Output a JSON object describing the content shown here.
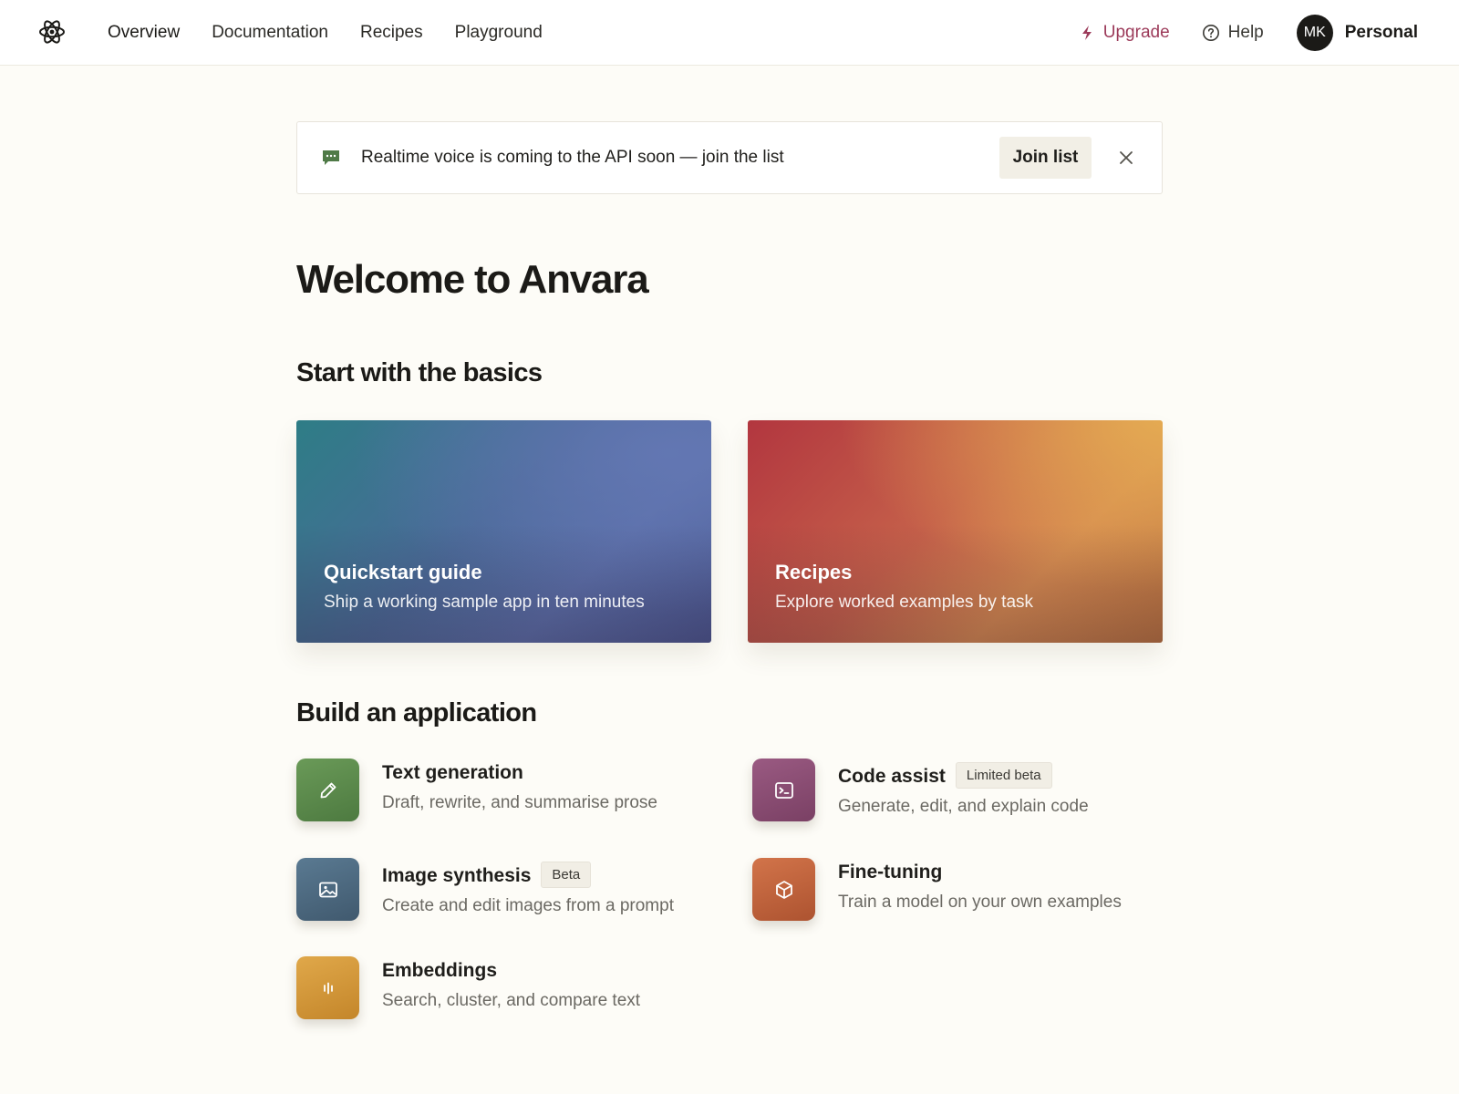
{
  "nav": {
    "logo": "atom-logo-icon",
    "links": [
      "Overview",
      "Documentation",
      "Recipes",
      "Playground"
    ],
    "upgrade_label": "Upgrade",
    "help_label": "Help",
    "avatar_initials": "MK",
    "account_label": "Personal"
  },
  "banner": {
    "icon": "chat-bubble-icon",
    "text": "Realtime voice is coming to the API soon — join the list",
    "button_label": "Join list",
    "close_icon": "close-icon"
  },
  "welcome_title": "Welcome to Anvara",
  "basics": {
    "title": "Start with the basics",
    "cards": [
      {
        "title": "Quickstart guide",
        "subtitle": "Ship a working sample app in ten minutes"
      },
      {
        "title": "Recipes",
        "subtitle": "Explore worked examples by task"
      }
    ]
  },
  "build": {
    "title": "Build an application",
    "apps": [
      {
        "icon": "pencil-icon",
        "title": "Text generation",
        "subtitle": "Draft, rewrite, and summarise prose",
        "badge": "",
        "color": "#5a8a4a"
      },
      {
        "icon": "terminal-icon",
        "title": "Code assist",
        "subtitle": "Generate, edit, and explain code",
        "badge": "Limited beta",
        "color": "#8a4d72"
      },
      {
        "icon": "image-icon",
        "title": "Image synthesis",
        "subtitle": "Create and edit images from a prompt",
        "badge": "Beta",
        "color": "#4d6a80"
      },
      {
        "icon": "cube-icon",
        "title": "Fine-tuning",
        "subtitle": "Train a model on your own examples",
        "badge": "",
        "color": "#c0623a"
      },
      {
        "icon": "bars-icon",
        "title": "Embeddings",
        "subtitle": "Search, cluster, and compare text",
        "badge": "",
        "color": "#d49a3a"
      }
    ]
  },
  "colors": {
    "background": "#fdfcf7",
    "upgrade_accent": "#9c3b5a"
  }
}
